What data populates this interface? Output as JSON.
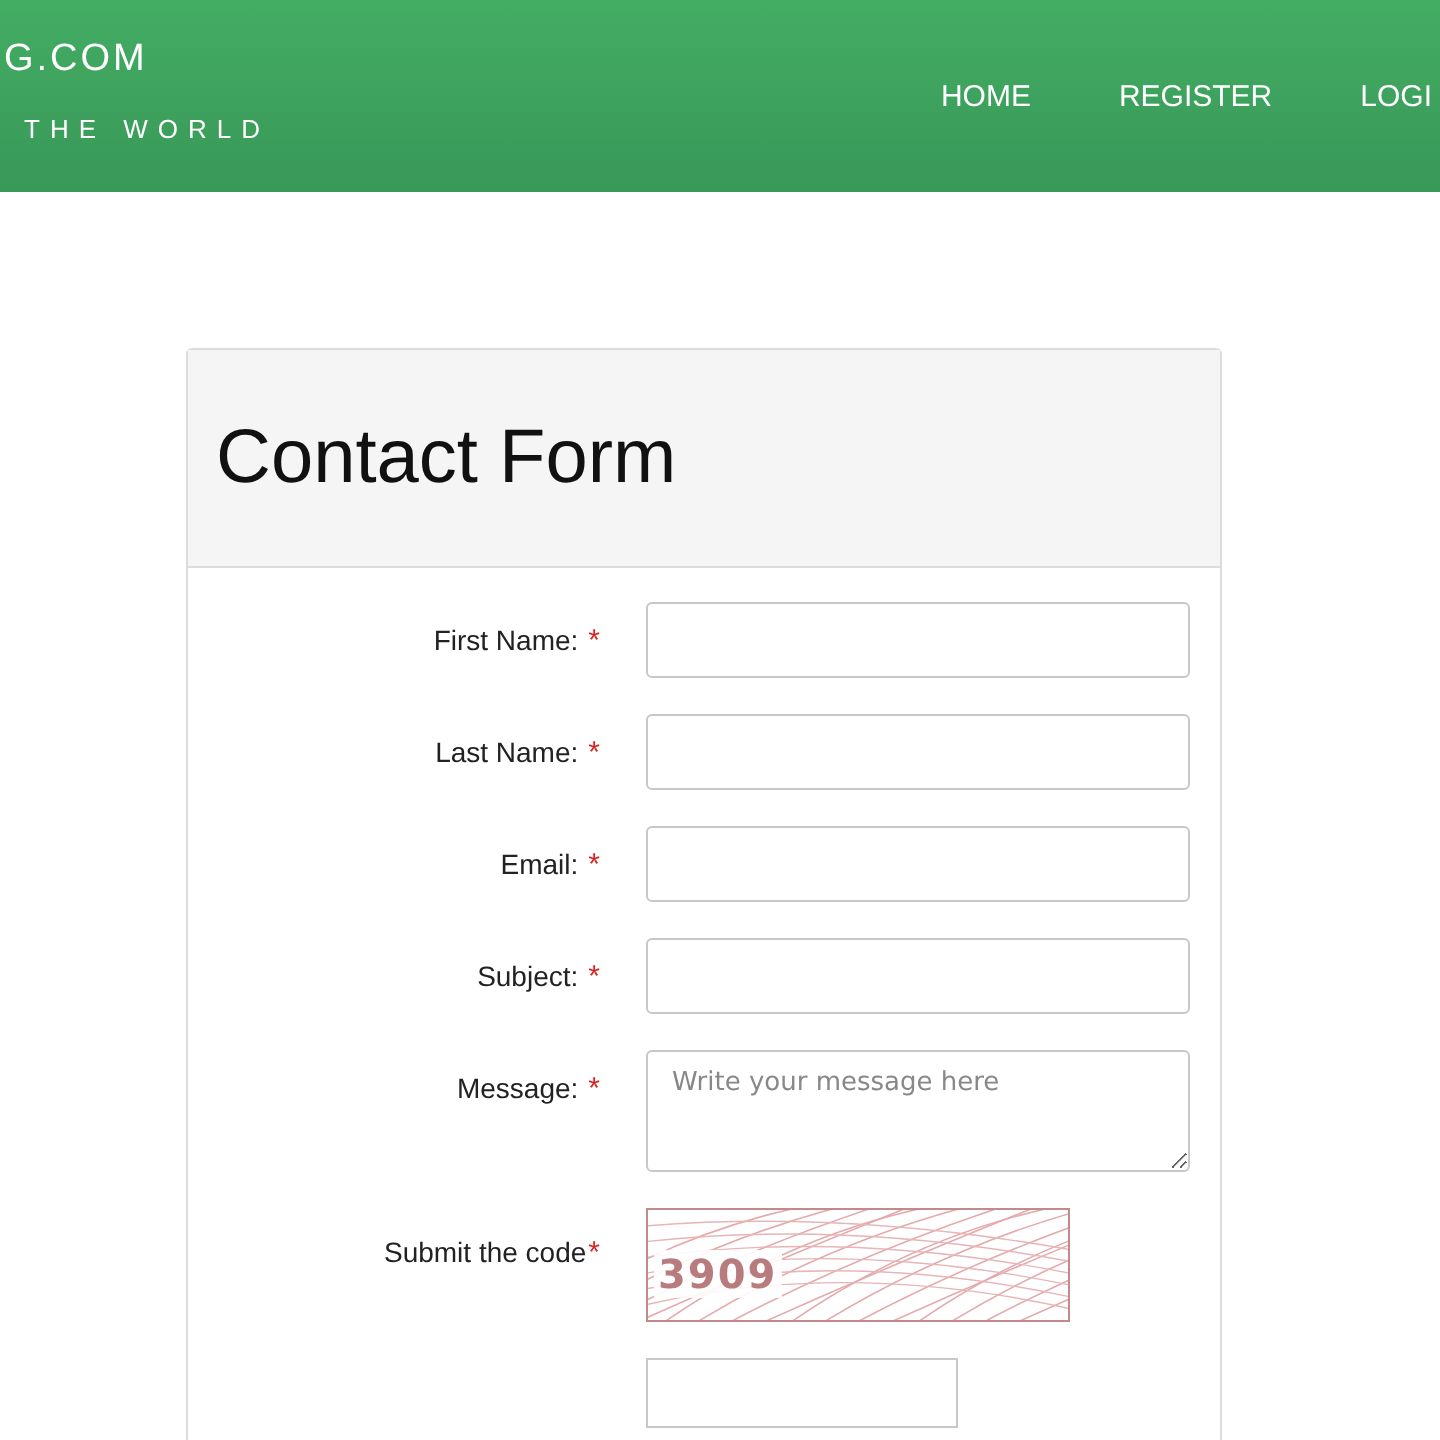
{
  "header": {
    "logo": "G.COM",
    "tagline": "THE WORLD",
    "nav": [
      {
        "label": "HOME"
      },
      {
        "label": "REGISTER"
      },
      {
        "label": "LOGI"
      }
    ]
  },
  "form": {
    "title": "Contact Form",
    "fields": [
      {
        "kind": "input",
        "label": "First Name:",
        "required_mark": "*"
      },
      {
        "kind": "input",
        "label": "Last Name:",
        "required_mark": "*"
      },
      {
        "kind": "input",
        "label": "Email:",
        "required_mark": "*"
      },
      {
        "kind": "input",
        "label": "Subject:",
        "required_mark": "*"
      },
      {
        "kind": "textarea",
        "label": "Message:",
        "required_mark": "*",
        "placeholder": "Write your message here"
      },
      {
        "kind": "captcha",
        "label": "Submit the code",
        "required_mark": "*",
        "code": "3909"
      }
    ]
  }
}
